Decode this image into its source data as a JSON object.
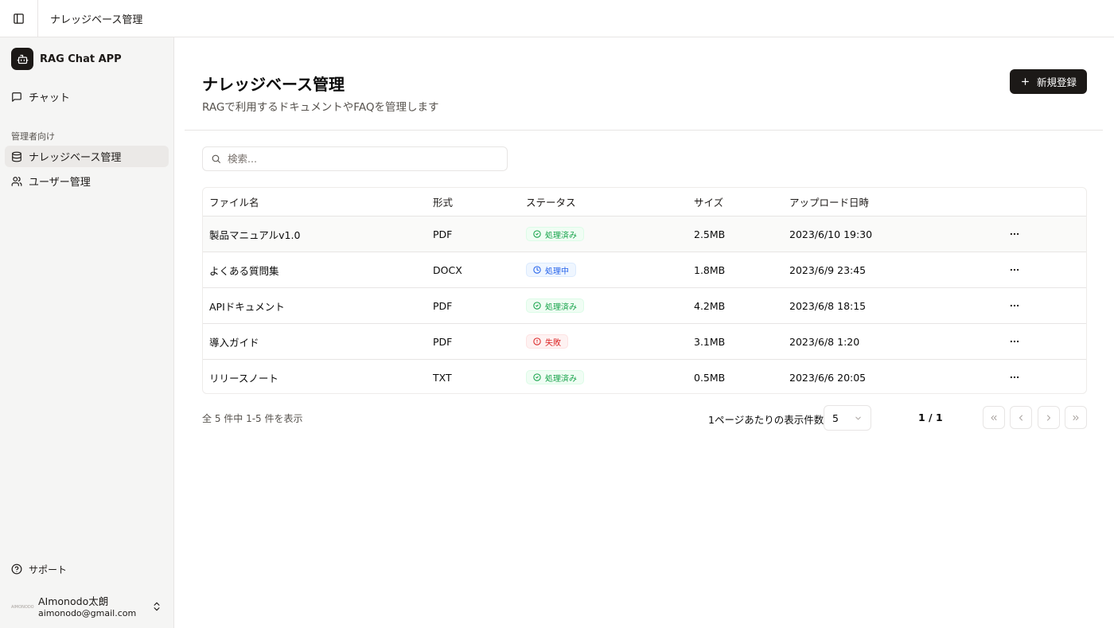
{
  "header": {
    "breadcrumb": "ナレッジベース管理"
  },
  "sidebar": {
    "app_name": "RAG Chat APP",
    "chat_label": "チャット",
    "section_label": "管理者向け",
    "knowledge_label": "ナレッジベース管理",
    "users_label": "ユーザー管理",
    "support_label": "サポート",
    "user": {
      "avatar_text": "AIMONODO",
      "name": "AImonodo太朗",
      "email": "aimonodo@gmail.com"
    }
  },
  "main": {
    "title": "ナレッジベース管理",
    "subtitle": "RAGで利用するドキュメントやFAQを管理します",
    "new_button": "新規登録",
    "search_placeholder": "検索..."
  },
  "table": {
    "headers": {
      "name": "ファイル名",
      "format": "形式",
      "status": "ステータス",
      "size": "サイズ",
      "date": "アップロード日時"
    },
    "rows": [
      {
        "name": "製品マニュアルv1.0",
        "format": "PDF",
        "status": "処理済み",
        "size": "2.5MB",
        "date": "2023/6/10 19:30"
      },
      {
        "name": "よくある質問集",
        "format": "DOCX",
        "status": "処理中",
        "size": "1.8MB",
        "date": "2023/6/9 23:45"
      },
      {
        "name": "APIドキュメント",
        "format": "PDF",
        "status": "処理済み",
        "size": "4.2MB",
        "date": "2023/6/8 18:15"
      },
      {
        "name": "導入ガイド",
        "format": "PDF",
        "status": "失敗",
        "size": "3.1MB",
        "date": "2023/6/8 1:20"
      },
      {
        "name": "リリースノート",
        "format": "TXT",
        "status": "処理済み",
        "size": "0.5MB",
        "date": "2023/6/6 20:05"
      }
    ]
  },
  "pagination": {
    "summary": "全 5 件中 1-5 件を表示",
    "per_page_label": "1ページあたりの表示件数",
    "per_page_value": "5",
    "page_indicator": "1 / 1"
  },
  "colors": {
    "primary": "#1c1917",
    "done": "#16a34a",
    "processing": "#2563eb",
    "failed": "#dc2626"
  }
}
